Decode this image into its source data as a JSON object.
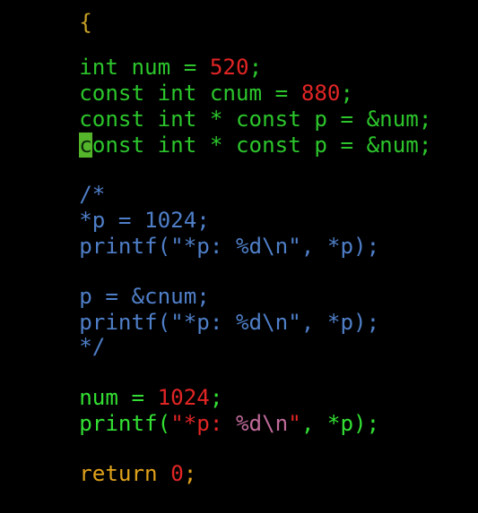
{
  "editor": {
    "top_fragment": "{",
    "lines": [
      {
        "tokens": [
          "int",
          " ",
          "num",
          " = ",
          "520",
          ";"
        ]
      },
      {
        "tokens": [
          "const",
          " ",
          "int",
          " ",
          "cnum",
          " = ",
          "880",
          ";"
        ]
      },
      {
        "tokens": [
          "const",
          " ",
          "int",
          " * ",
          "const",
          " ",
          "p",
          " = ",
          "&num",
          ";"
        ]
      },
      {
        "tokens": [
          "c",
          "onst",
          " ",
          "int",
          " * ",
          "const",
          " ",
          "p",
          " = ",
          "&num",
          ";"
        ]
      },
      {
        "tokens": [
          "/*"
        ]
      },
      {
        "tokens": [
          "*p = 1024;"
        ]
      },
      {
        "tokens": [
          "printf(\"*p: %d\\n\", *p);"
        ]
      },
      {
        "tokens": [
          "p = &cnum;"
        ]
      },
      {
        "tokens": [
          "printf(\"*p: %d\\n\", *p);"
        ]
      },
      {
        "tokens": [
          "*/"
        ]
      },
      {
        "tokens": [
          "num",
          " = ",
          "1024",
          ";"
        ]
      },
      {
        "tokens": [
          "printf(",
          "\"*p: ",
          "%d\\n",
          "\"",
          ", *p);"
        ]
      },
      {
        "tokens": [
          "return",
          " ",
          "0",
          ";"
        ]
      }
    ]
  },
  "colors": {
    "background": "#000000",
    "keyword": "#2cc62c",
    "number": "#e22525",
    "comment": "#4f7fc8",
    "string": "#c06a9a",
    "return": "#e0a21b",
    "cursor": "#54b52b"
  }
}
